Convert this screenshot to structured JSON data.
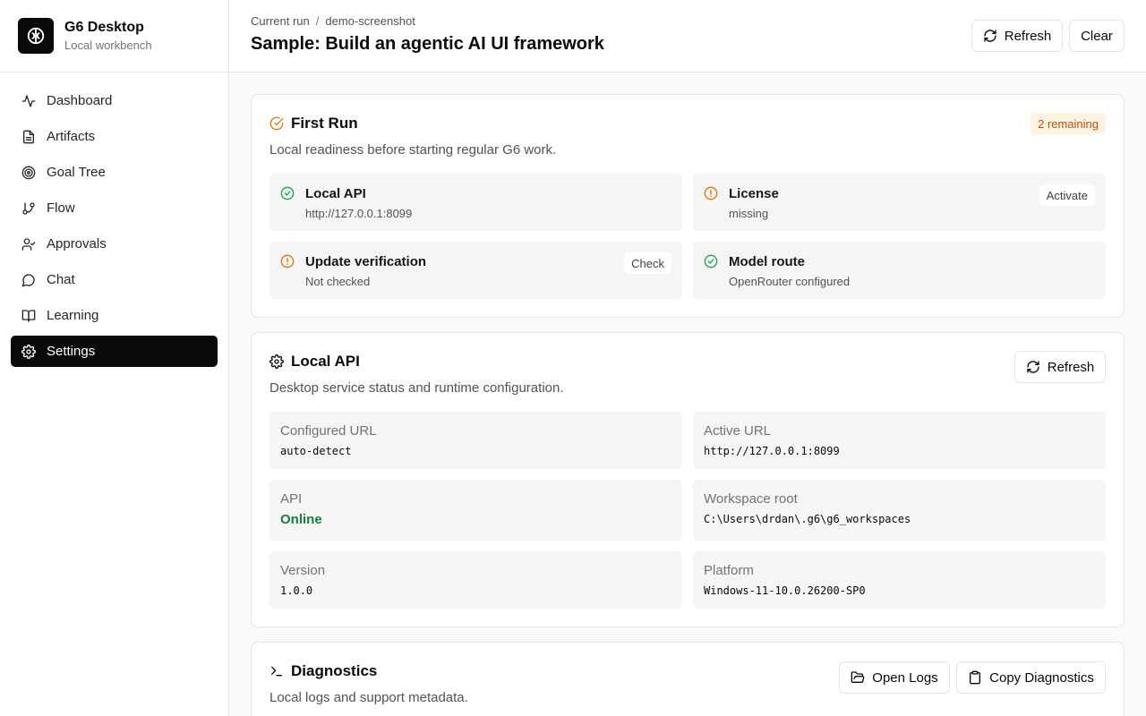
{
  "brand": {
    "title": "G6 Desktop",
    "subtitle": "Local workbench",
    "logo_icon": "brain-icon"
  },
  "sidebar": {
    "items": [
      {
        "label": "Dashboard",
        "icon": "activity-icon",
        "active": false
      },
      {
        "label": "Artifacts",
        "icon": "file-text-icon",
        "active": false
      },
      {
        "label": "Goal Tree",
        "icon": "target-icon",
        "active": false
      },
      {
        "label": "Flow",
        "icon": "git-branch-icon",
        "active": false
      },
      {
        "label": "Approvals",
        "icon": "user-check-icon",
        "active": false
      },
      {
        "label": "Chat",
        "icon": "message-circle-icon",
        "active": false
      },
      {
        "label": "Learning",
        "icon": "book-open-icon",
        "active": false
      },
      {
        "label": "Settings",
        "icon": "settings-icon",
        "active": true
      }
    ]
  },
  "header": {
    "breadcrumb": {
      "parent": "Current run",
      "separator": "/",
      "current": "demo-screenshot"
    },
    "title": "Sample: Build an agentic AI UI framework",
    "refresh_label": "Refresh",
    "clear_label": "Clear"
  },
  "first_run": {
    "title": "First Run",
    "description": "Local readiness before starting regular G6 work.",
    "badge": "2 remaining",
    "checks": [
      {
        "title": "Local API",
        "detail": "http://127.0.0.1:8099",
        "status": "ok",
        "action": ""
      },
      {
        "title": "License",
        "detail": "missing",
        "status": "warn",
        "action": "Activate"
      },
      {
        "title": "Update verification",
        "detail": "Not checked",
        "status": "warn",
        "action": "Check"
      },
      {
        "title": "Model route",
        "detail": "OpenRouter configured",
        "status": "ok",
        "action": ""
      }
    ]
  },
  "local_api": {
    "title": "Local API",
    "description": "Desktop service status and runtime configuration.",
    "refresh_label": "Refresh",
    "fields": {
      "configured_url": {
        "label": "Configured URL",
        "value": "auto-detect"
      },
      "active_url": {
        "label": "Active URL",
        "value": "http://127.0.0.1:8099"
      },
      "api": {
        "label": "API",
        "value": "Online"
      },
      "workspace_root": {
        "label": "Workspace root",
        "value": "C:\\Users\\drdan\\.g6\\g6_workspaces"
      },
      "version": {
        "label": "Version",
        "value": "1.0.0"
      },
      "platform": {
        "label": "Platform",
        "value": "Windows-11-10.0.26200-SP0"
      }
    }
  },
  "diagnostics": {
    "title": "Diagnostics",
    "description": "Local logs and support metadata.",
    "open_logs_label": "Open Logs",
    "copy_label": "Copy Diagnostics"
  },
  "colors": {
    "ok": "#16a34a",
    "warn": "#d97706",
    "accent": "#0a0a0a",
    "online": "#15803d"
  }
}
